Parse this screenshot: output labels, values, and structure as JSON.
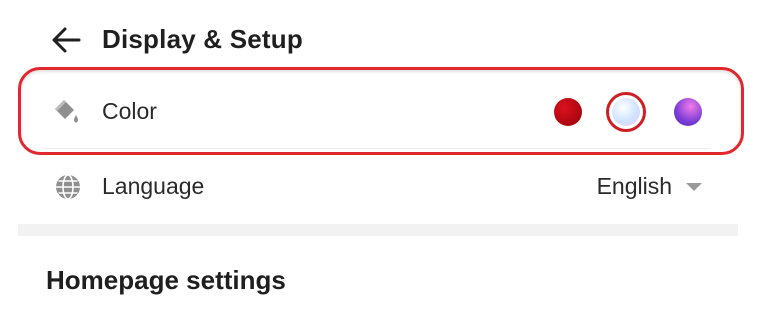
{
  "header": {
    "title": "Display & Setup",
    "back_icon": "arrow-left-icon"
  },
  "color_row": {
    "label": "Color",
    "icon": "paint-bucket-icon",
    "swatches": [
      {
        "name": "red",
        "color": "#b00010",
        "selected": false
      },
      {
        "name": "pastel",
        "color": "#cfe5ff",
        "selected": true
      },
      {
        "name": "purple",
        "color": "#7a3cd6",
        "selected": false
      }
    ],
    "highlight_color": "#e0282e"
  },
  "language_row": {
    "label": "Language",
    "icon": "globe-icon",
    "value": "English",
    "dropdown_icon": "caret-down-icon"
  },
  "homepage": {
    "title": "Homepage settings"
  }
}
